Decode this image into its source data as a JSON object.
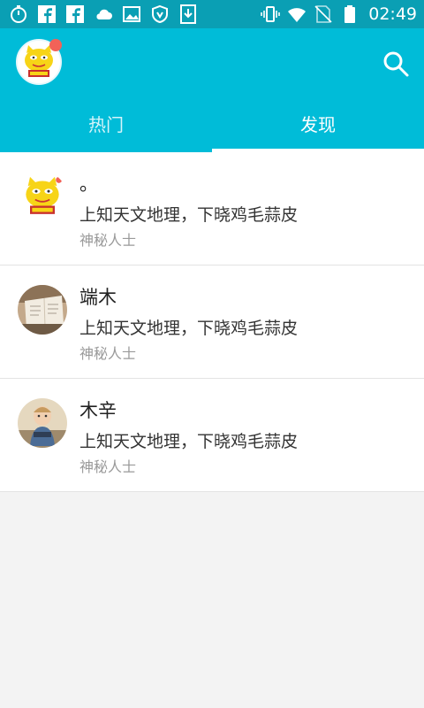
{
  "status_bar": {
    "time": "02:49",
    "icons": [
      "stopwatch-icon",
      "facebook-icon",
      "facebook-icon",
      "cloud-icon",
      "image-icon",
      "shield-icon",
      "download-icon",
      "vibrate-icon",
      "wifi-icon",
      "no-sim-icon",
      "battery-icon"
    ]
  },
  "header": {
    "avatar_icon": "profile-avatar",
    "search_icon": "search-icon"
  },
  "tabs": [
    {
      "label": "热门",
      "active": false
    },
    {
      "label": "发现",
      "active": true
    }
  ],
  "list": [
    {
      "name": "。",
      "bio": "上知天文地理，下晓鸡毛蒜皮",
      "meta": "神秘人士",
      "avatar": "cartoon-avatar"
    },
    {
      "name": "端木",
      "bio": "上知天文地理，下晓鸡毛蒜皮",
      "meta": "神秘人士",
      "avatar": "book-photo-avatar"
    },
    {
      "name": "木辛",
      "bio": "上知天文地理，下晓鸡毛蒜皮",
      "meta": "神秘人士",
      "avatar": "child-photo-avatar"
    }
  ],
  "colors": {
    "status_bar": "#0a9fb4",
    "app_bar": "#00bcd8",
    "background": "#f3f3f3",
    "badge": "#f26258"
  }
}
